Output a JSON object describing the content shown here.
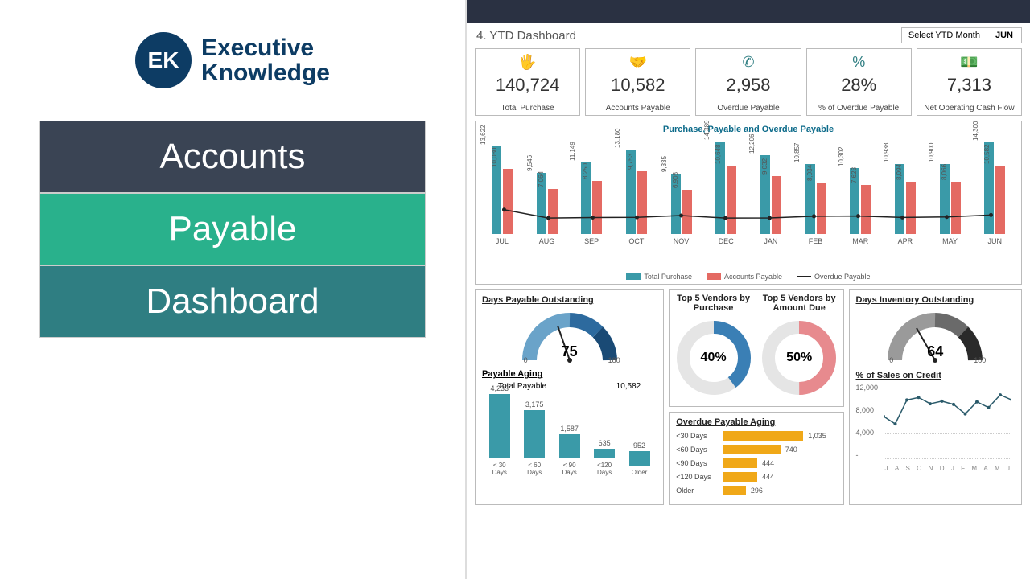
{
  "brand": {
    "badge": "EK",
    "name_l1": "Executive",
    "name_l2": "Knowledge"
  },
  "title_rows": [
    "Accounts",
    "Payable",
    "Dashboard"
  ],
  "header": {
    "title": "4. YTD Dashboard",
    "selector_label": "Select YTD Month",
    "selector_value": "JUN"
  },
  "cards": [
    {
      "icon": "🖐",
      "value": "140,724",
      "label": "Total Purchase"
    },
    {
      "icon": "🤝",
      "value": "10,582",
      "label": "Accounts Payable"
    },
    {
      "icon": "✆",
      "value": "2,958",
      "label": "Overdue Payable"
    },
    {
      "icon": "%",
      "value": "28%",
      "label": "% of Overdue Payable"
    },
    {
      "icon": "💵",
      "value": "7,313",
      "label": "Net Operating Cash Flow"
    }
  ],
  "chart_data": {
    "main": {
      "type": "bar",
      "title": "Purchase, Payable and Overdue Payable",
      "categories": [
        "JUL",
        "AUG",
        "SEP",
        "OCT",
        "NOV",
        "DEC",
        "JAN",
        "FEB",
        "MAR",
        "APR",
        "MAY",
        "JUN"
      ],
      "series": [
        {
          "name": "Total Purchase",
          "values": [
            13622,
            9546,
            11149,
            13180,
            9335,
            14389,
            12206,
            10857,
            10302,
            10938,
            10900,
            14300
          ]
        },
        {
          "name": "Accounts Payable",
          "values": [
            10080,
            7064,
            8250,
            9753,
            6908,
            10648,
            9032,
            8034,
            7623,
            8094,
            8066,
            10582
          ]
        },
        {
          "name": "Overdue Payable",
          "type": "line",
          "values": [
            3780,
            2485,
            2560,
            2600,
            2880,
            2480,
            2500,
            2760,
            2791,
            2575,
            2656,
            2958
          ]
        }
      ],
      "ylim": [
        0,
        15000
      ]
    },
    "dpo_gauge": {
      "type": "gauge",
      "title": "Days Payable Outstanding",
      "value": 75,
      "min": 0,
      "max": 180
    },
    "payable_aging": {
      "type": "bar",
      "title": "Payable Aging",
      "total_label": "Total Payable",
      "total_value": "10,582",
      "categories": [
        "< 30 Days",
        "< 60 Days",
        "< 90 Days",
        "<120 Days",
        "Older"
      ],
      "values": [
        4233,
        3175,
        1587,
        635,
        952
      ]
    },
    "top5_purchase": {
      "type": "donut",
      "title": "Top 5 Vendors by Purchase",
      "value": "40%",
      "pct": 40,
      "color": "#3a7fb5"
    },
    "top5_due": {
      "type": "donut",
      "title": "Top 5 Vendors by Amount Due",
      "value": "50%",
      "pct": 50,
      "color": "#e78a8e"
    },
    "overdue_aging": {
      "type": "bar",
      "orientation": "horizontal",
      "title": "Overdue Payable Aging",
      "categories": [
        "<30 Days",
        "<60 Days",
        "<90 Days",
        "<120 Days",
        "Older"
      ],
      "values": [
        1035,
        740,
        444,
        444,
        296
      ]
    },
    "dio_gauge": {
      "type": "gauge",
      "title": "Days Inventory Outstanding",
      "value": 64,
      "min": 0,
      "max": 180
    },
    "sales_credit": {
      "type": "line",
      "title": "% of Sales on Credit",
      "x": [
        "J",
        "A",
        "S",
        "O",
        "N",
        "D",
        "J",
        "F",
        "M",
        "A",
        "M",
        "J"
      ],
      "values": [
        6800,
        5600,
        9400,
        9800,
        8800,
        9200,
        8700,
        7200,
        9100,
        8200,
        10200,
        9400
      ],
      "yticks": [
        "12,000",
        "8,000",
        "4,000",
        "-"
      ],
      "ylim": [
        0,
        12000
      ]
    }
  }
}
